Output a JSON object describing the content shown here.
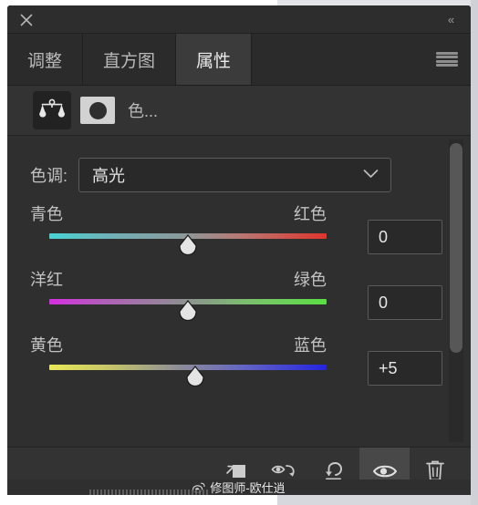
{
  "titlebar": {
    "close_icon": "close-icon",
    "collapse_icon": "double-chevron-left-icon",
    "collapse_glyph": "«"
  },
  "tabs": [
    {
      "label": "调整",
      "active": false
    },
    {
      "label": "直方图",
      "active": false
    },
    {
      "label": "属性",
      "active": true
    }
  ],
  "panel_menu": {
    "icon": "hamburger-menu-icon"
  },
  "adjustment": {
    "thumbnail_icon": "color-balance-scales-icon",
    "mask_icon": "layer-mask-icon",
    "title": "色..."
  },
  "tone": {
    "label": "色调:",
    "value": "高光",
    "chevron_icon": "chevron-down-icon"
  },
  "sliders": [
    {
      "left_label": "青色",
      "right_label": "红色",
      "value": "0",
      "thumb_percent": 50,
      "gradient_class": "t-cyan-red",
      "name": "cyan-red"
    },
    {
      "left_label": "洋红",
      "right_label": "绿色",
      "value": "0",
      "thumb_percent": 50,
      "gradient_class": "t-mag-green",
      "name": "magenta-green"
    },
    {
      "left_label": "黄色",
      "right_label": "蓝色",
      "value": "+5",
      "thumb_percent": 52.5,
      "gradient_class": "t-yel-blue",
      "name": "yellow-blue"
    }
  ],
  "toolbar": [
    {
      "icon": "clip-to-layer-icon",
      "active": false
    },
    {
      "icon": "toggle-previous-state-eye-icon",
      "active": false
    },
    {
      "icon": "reset-icon",
      "active": false
    },
    {
      "icon": "visibility-eye-icon",
      "active": true
    },
    {
      "icon": "delete-trash-icon",
      "active": false
    }
  ],
  "watermark": {
    "icon": "weibo-icon",
    "text": "修图师-欧仕逍"
  },
  "colors": {
    "panel_bg": "#2b2b2b",
    "body_bg": "#2f2f2f",
    "header_bg": "#333333",
    "active_tab_bg": "#3b3b3b",
    "text": "#c3c3c3"
  }
}
